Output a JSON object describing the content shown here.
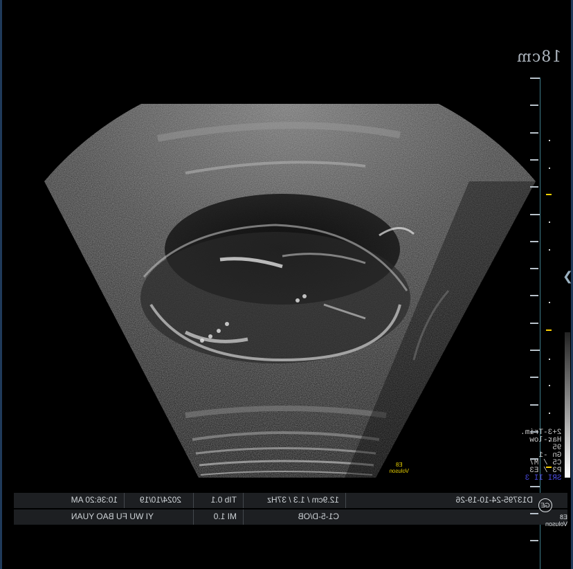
{
  "depth": {
    "label": "18cm"
  },
  "info_bar": {
    "row1": {
      "patient_id": "D13795-24-10-19-26",
      "scan_params": "12.9cm / 1.3 / 37Hz",
      "tib": "TIb 0.1",
      "date": "2024/10/19",
      "time": "10:36:20 AM"
    },
    "row2": {
      "probe_preset": "C1-5-D/OB",
      "mi": "MI 1.0",
      "hospital": "YI WU FU BAO YUAN"
    }
  },
  "brand": {
    "logo_icon": "ge-logo-icon",
    "name": "Voluson",
    "model": "E8"
  },
  "probe_logo": {
    "name": "Voluson",
    "model": "E8"
  },
  "params": {
    "line1": "2+3-Trim.",
    "line2": "Har-low",
    "line3": "95",
    "line4": "Gn -1",
    "line5": "C5 / M7",
    "line6": "P3 / E3",
    "line7": "SRI II 3"
  },
  "colors": {
    "background": "#000000",
    "ruler": "#3f7e8c",
    "focus_marker": "#ffd200",
    "text": "#cfd4d8",
    "info_bar": "#1d1f22"
  },
  "icons": {
    "focus_pointer": "chevron-right-icon"
  }
}
